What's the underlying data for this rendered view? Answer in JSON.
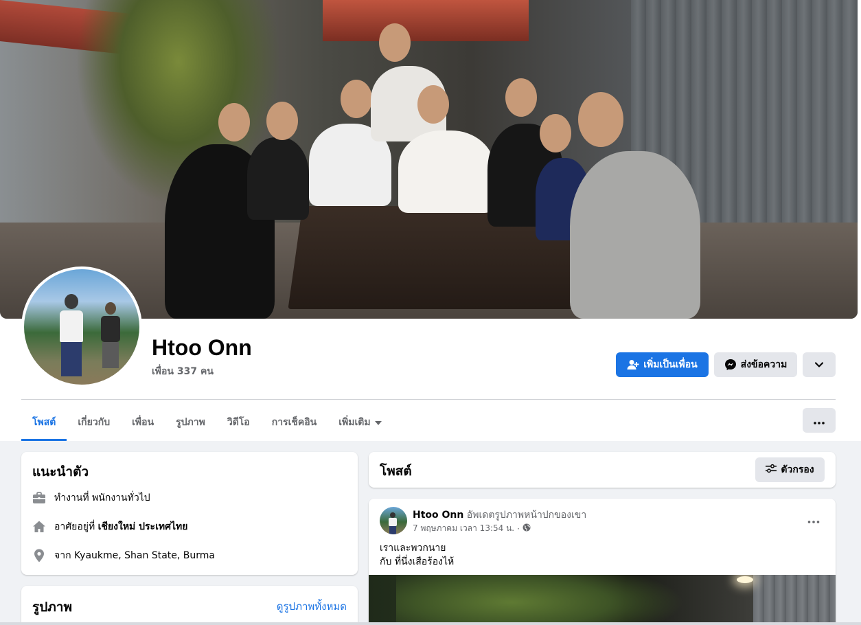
{
  "profile": {
    "name": "Htoo Onn",
    "friends_count": "เพื่อน 337 คน"
  },
  "actions": {
    "add_friend_label": "เพิ่มเป็นเพื่อน",
    "message_label": "ส่งข้อความ"
  },
  "tabs": [
    {
      "label": "โพสต์",
      "active": true
    },
    {
      "label": "เกี่ยวกับ",
      "active": false
    },
    {
      "label": "เพื่อน",
      "active": false
    },
    {
      "label": "รูปภาพ",
      "active": false
    },
    {
      "label": "วิดีโอ",
      "active": false
    },
    {
      "label": "การเช็คอิน",
      "active": false
    },
    {
      "label": "เพิ่มเติม",
      "active": false
    }
  ],
  "intro": {
    "title": "แนะนำตัว",
    "work_prefix": "ทำงานที่ ",
    "work_value": "พนักงานทั่วไป",
    "lives_prefix": "อาศัยอยู่ที่ ",
    "lives_value": "เชียงใหม่ ประเทศไทย",
    "from_prefix": "จาก ",
    "from_value": "Kyaukme, Shan State, Burma"
  },
  "photos": {
    "title": "รูปภาพ",
    "see_all": "ดูรูปภาพทั้งหมด"
  },
  "posts": {
    "title": "โพสต์",
    "filter_label": "ตัวกรอง"
  },
  "post": {
    "author": "Htoo Onn",
    "action": " อัพเดตรูปภาพหน้าปกของเขา",
    "timestamp": "7 พฤษภาคม เวลา 13:54 น.",
    "separator": "·",
    "text_line1": "เราและพวกนาย",
    "text_line2": "กับ ที่นึ่งเสือร้องไห้"
  },
  "colors": {
    "accent": "#1b74e4",
    "background": "#f0f2f5",
    "secondary_text": "#65676b",
    "button_gray": "#e4e6eb"
  },
  "icons": [
    "person-plus-icon",
    "messenger-icon",
    "chevron-down-icon",
    "more-dots-icon",
    "briefcase-icon",
    "home-icon",
    "location-pin-icon",
    "filter-sliders-icon",
    "globe-icon",
    "caret-down-icon"
  ]
}
